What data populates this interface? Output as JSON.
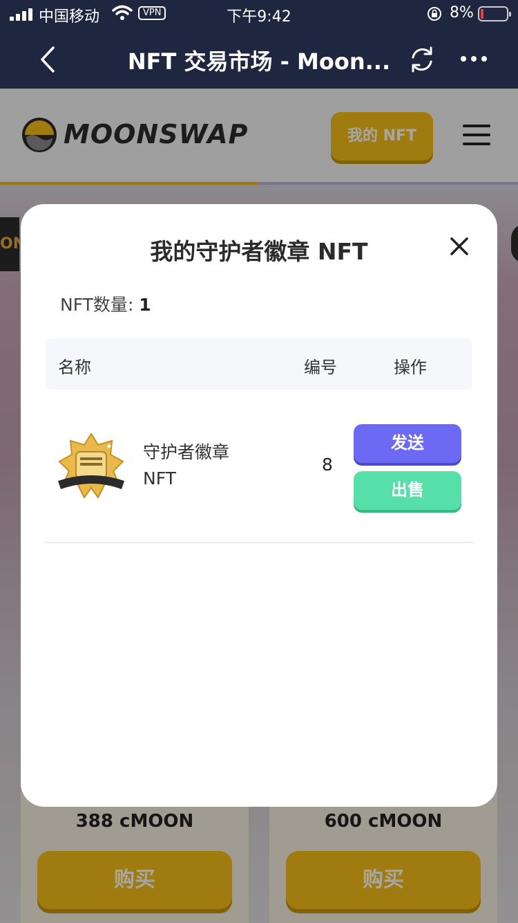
{
  "status_bar": {
    "carrier": "中国移动",
    "vpn": "VPN",
    "time": "下午9:42",
    "battery": "8%"
  },
  "nav": {
    "title": "NFT 交易市场 - Moon..."
  },
  "site": {
    "logo_text": "MOONSWAP",
    "my_nft_button": "我的 NFT",
    "side_tab": "ON",
    "accent_color": "#f4be1a"
  },
  "cards": [
    {
      "price": "388 cMOON",
      "buy": "购买"
    },
    {
      "price": "600 cMOON",
      "buy": "购买"
    }
  ],
  "modal": {
    "title": "我的守护者徽章 NFT",
    "count_label": "NFT数量:",
    "count_value": "1",
    "columns": {
      "name": "名称",
      "number": "编号",
      "action": "操作"
    },
    "rows": [
      {
        "name": "守护者徽章 NFT",
        "number": "8",
        "send": "发送",
        "sell": "出售"
      }
    ],
    "send_color": "#6c6af4",
    "sell_color": "#57dfa9"
  }
}
